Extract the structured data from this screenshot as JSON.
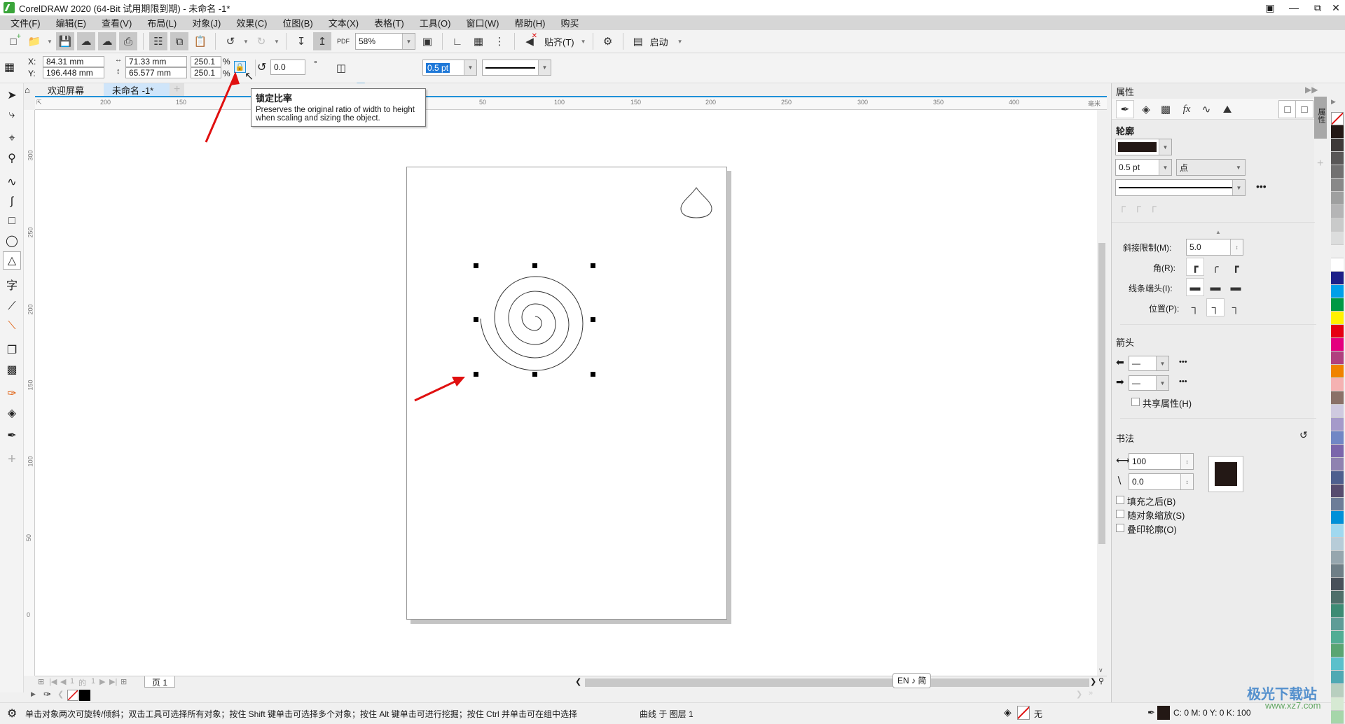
{
  "window": {
    "title": "CorelDRAW 2020 (64-Bit 试用期限到期) - 未命名 -1*",
    "controls": [
      "account-icon",
      "minimize",
      "restore",
      "close"
    ]
  },
  "menu": [
    "文件(F)",
    "编辑(E)",
    "查看(V)",
    "布局(L)",
    "对象(J)",
    "效果(C)",
    "位图(B)",
    "文本(X)",
    "表格(T)",
    "工具(O)",
    "窗口(W)",
    "帮助(H)",
    "购买"
  ],
  "standard_toolbar": {
    "zoom_level": "58%",
    "snap_label": "贴齐(T)",
    "launch_label": "启动"
  },
  "property_bar": {
    "x_label": "X:",
    "y_label": "Y:",
    "x_value": "84.31 mm",
    "y_value": "196.448 mm",
    "width_value": "71.33 mm",
    "height_value": "65.577 mm",
    "scale_x": "250.1",
    "scale_y": "250.1",
    "percent": "%",
    "rotation": "0.0",
    "degree_symbol": "°",
    "outline_width": "0.5 pt"
  },
  "tooltip": {
    "title": "锁定比率",
    "line1": "Preserves the original ratio of width to height",
    "line2": "when scaling and sizing the object."
  },
  "doc_tabs": [
    {
      "label": "欢迎屏幕",
      "active": false
    },
    {
      "label": "未命名 -1*",
      "active": true
    }
  ],
  "rulers": {
    "horizontal_labels": [
      "200",
      "150",
      "50",
      "100",
      "150",
      "200",
      "250",
      "300",
      "350",
      "400"
    ],
    "unit": "毫米",
    "vertical_labels": [
      "300",
      "250",
      "200",
      "150",
      "100",
      "50",
      "0"
    ]
  },
  "page_nav": {
    "current": "1",
    "of_label": "的",
    "total": "1",
    "page_tab": "页 1"
  },
  "ime_indicator": "EN ♪ 简",
  "status": {
    "hint": "单击对象两次可旋转/倾斜；双击工具可选择所有对象；按住 Shift 键单击可选择多个对象；按住 Alt 键单击可进行挖掘；按住 Ctrl 并单击可在组中选择",
    "object_info": "曲线 于 图层 1",
    "fill_label": "无",
    "outline_color": "C: 0 M: 0 Y: 0 K: 100"
  },
  "docker": {
    "title": "属性",
    "side_tab": "属性",
    "outline_heading": "轮廓",
    "width_value": "0.5 pt",
    "unit_value": "点",
    "miter_label": "斜接限制(M):",
    "miter_value": "5.0",
    "corner_label": "角(R):",
    "linecap_label": "线条端头(I):",
    "position_label": "位置(P):",
    "arrows_heading": "箭头",
    "share_attr_label": "共享属性(H)",
    "calligraphy_heading": "书法",
    "stretch_value": "100",
    "angle_value": "0.0",
    "fill_behind_label": "填充之后(B)",
    "scale_with_object_label": "随对象缩放(S)",
    "overprint_label": "叠印轮廓(O)"
  },
  "colors": {
    "accent": "#1e90d8",
    "outline_swatch": "#231815",
    "annotation_arrow": "#e01010"
  },
  "palette": [
    "#231815",
    "#3e3a39",
    "#595757",
    "#727171",
    "#898989",
    "#9fa0a0",
    "#b5b5b6",
    "#c9caca",
    "#dcdddd",
    "#efefef",
    "#ffffff",
    "#1d2088",
    "#00a0e9",
    "#009944",
    "#fff100",
    "#e60012",
    "#e4007f",
    "#b0407f",
    "#f08300",
    "#f5b2b2",
    "#8a7168",
    "#cfcae0",
    "#a59aca",
    "#7187c5",
    "#7b66ab",
    "#8f82b0",
    "#4e5f8e",
    "#574c6f",
    "#6d7d98",
    "#0090d8",
    "#a0d8ef",
    "#b7ccd8",
    "#96a6ae",
    "#6f7f87",
    "#48515a",
    "#4f6f6a",
    "#3d8b74",
    "#5f9c97",
    "#52ad94",
    "#5aa572",
    "#5bc0cb",
    "#4fa9b3",
    "#b8cfbf",
    "#d6e9d3",
    "#a6d6aa"
  ],
  "watermark": {
    "site": "极光下载站",
    "url": "www.xz7.com"
  }
}
